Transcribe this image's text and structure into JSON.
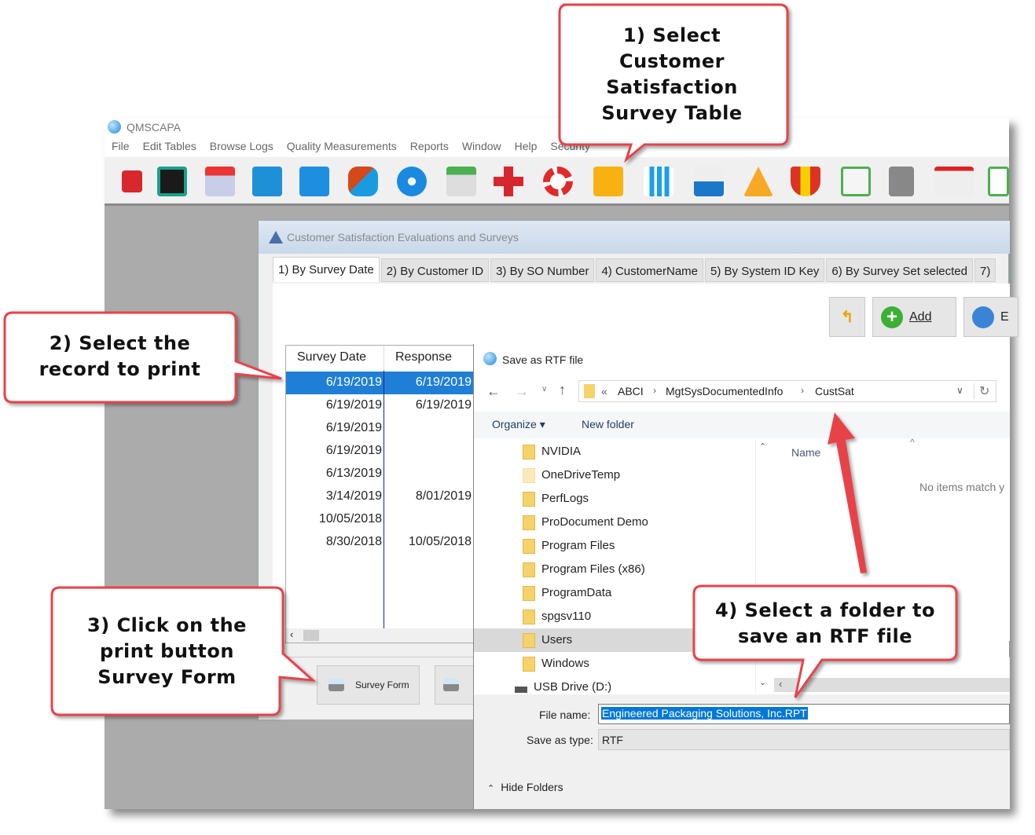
{
  "app": {
    "title": "QMSCAPA",
    "menu": [
      "File",
      "Edit Tables",
      "Browse Logs",
      "Quality Measurements",
      "Reports",
      "Window",
      "Help",
      "Security"
    ],
    "toolbar_icons": [
      "power-icon",
      "form-icon",
      "pdf-document-icon",
      "notebook-pencil-icon",
      "org-chart-icon",
      "chat-bubbles-icon",
      "gear-icon",
      "calendar-icon",
      "red-cross-icon",
      "lifebuoy-icon",
      "customer-satisfaction-survey-icon",
      "bar-chart-icon",
      "printer-icon",
      "warning-icon",
      "shield-icon",
      "checklist-icon",
      "server-add-icon",
      "business-card-icon",
      "clipboard-chart-icon"
    ]
  },
  "child": {
    "title": "Customer Satisfaction Evaluations and Surveys",
    "tabs": [
      "1) By Survey Date",
      "2) By Customer ID",
      "3) By SO Number",
      "4) CustomerName",
      "5) By System ID Key",
      "6) By Survey Set selected",
      "7)"
    ],
    "buttons": {
      "add": "Add",
      "edit": "E"
    },
    "grid": {
      "columns": [
        "Survey Date",
        "Response"
      ],
      "rows": [
        [
          "6/19/2019",
          "6/19/2019"
        ],
        [
          "6/19/2019",
          "6/19/2019"
        ],
        [
          "6/19/2019",
          ""
        ],
        [
          "6/19/2019",
          ""
        ],
        [
          "6/13/2019",
          ""
        ],
        [
          "3/14/2019",
          "8/01/2019"
        ],
        [
          "10/05/2018",
          ""
        ],
        [
          "8/30/2018",
          "10/05/2018"
        ]
      ],
      "selected_row": 0
    },
    "print_button": "Survey Form"
  },
  "dialog": {
    "title": "Save as RTF file",
    "path": [
      "ABCI",
      "MgtSysDocumentedInfo",
      "CustSat"
    ],
    "path_prefix": "«",
    "organize": "Organize",
    "new_folder": "New folder",
    "folders": [
      "NVIDIA",
      "OneDriveTemp",
      "PerfLogs",
      "ProDocument Demo",
      "Program Files",
      "Program Files (x86)",
      "ProgramData",
      "spgsv110",
      "Users",
      "Windows"
    ],
    "selected_folder": "Users",
    "drive": "USB Drive (D:)",
    "name_header": "Name",
    "empty_text": "No items match y",
    "file_name_label": "File name:",
    "file_name": "Engineered Packaging Solutions, Inc.RPT",
    "save_type_label": "Save as type:",
    "save_type": "RTF",
    "hide_folders": "Hide Folders"
  },
  "callouts": {
    "c1": "1) Select Customer Satisfaction Survey Table",
    "c2": "2) Select the record to print",
    "c3": "3) Click on the print button Survey Form",
    "c4": "4) Select a folder to save an RTF file"
  },
  "colors": {
    "callout_border": "#e8434a",
    "selection": "#1f7fd6",
    "arrow": "#e8434a"
  }
}
